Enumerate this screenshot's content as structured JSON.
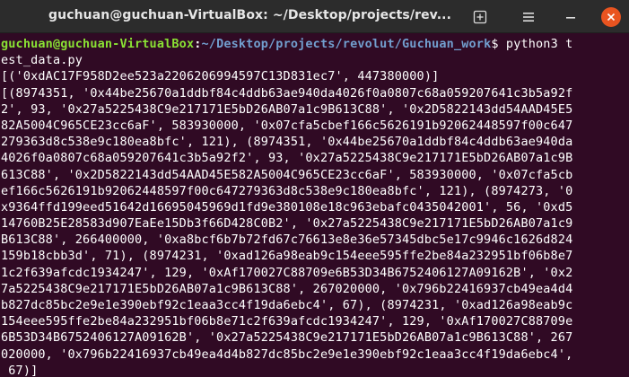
{
  "window": {
    "title": "guchuan@guchuan-VirtualBox: ~/Desktop/projects/revolut/Guchuan_work"
  },
  "titlebar_icons": {
    "new_tab": "new-tab-icon",
    "menu": "hamburger-menu-icon",
    "minimize": "minimize-icon",
    "close": "close-icon"
  },
  "terminal": {
    "prompt_user": "guchuan@guchuan-VirtualBox",
    "prompt_sep": ":",
    "prompt_path": "~/Desktop/projects/revolut/Guchuan_work",
    "prompt_symbol": "$ ",
    "command_head": "python3 t",
    "lines": [
      "est_data.py",
      "[('0xdAC17F958D2ee523a2206206994597C13D831ec7', 447380000)]",
      "[(8974351, '0x44be25670a1ddbf84c4ddb63ae940da4026f0a0807c68a059207641c3b5a92f",
      "2', 93, '0x27a5225438C9e217171E5bD26AB07a1c9B613C88', '0x2D5822143dd54AAD45E5",
      "82A5004C965CE23cc6aF', 583930000, '0x07cfa5cbef166c5626191b92062448597f00c647",
      "279363d8c538e9c180ea8bfc', 121), (8974351, '0x44be25670a1ddbf84c4ddb63ae940da",
      "4026f0a0807c68a059207641c3b5a92f2', 93, '0x27a5225438C9e217171E5bD26AB07a1c9B",
      "613C88', '0x2D5822143dd54AAD45E582A5004C965CE23cc6aF', 583930000, '0x07cfa5cb",
      "ef166c5626191b92062448597f00c647279363d8c538e9c180ea8bfc', 121), (8974273, '0",
      "x9364ffd199eed51642d16695045969d1fd9e380108e18c963ebafc0435042001', 56, '0xd5",
      "14760B25E28583d907EaEe15Db3f66D428C0B2', '0x27a5225438C9e217171E5bD26AB07a1c9",
      "B613C88', 266400000, '0xa8bcf6b7b72fd67c76613e8e36e57345dbc5e17c9946c1626d824",
      "159b18cbb3d', 71), (8974231, '0xad126a98eab9c154eee595ffe2be84a232951bf06b8e7",
      "1c2f639afcdc1934247', 129, '0xAf170027C88709e6B53D34B6752406127A09162B', '0x2",
      "7a5225438C9e217171E5bD26AB07a1c9B613C88', 267020000, '0x796b22416937cb49ea4d4",
      "b827dc85bc2e9e1e390ebf92c1eaa3cc4f19da6ebc4', 67), (8974231, '0xad126a98eab9c",
      "154eee595ffe2be84a232951bf06b8e71c2f639afcdc1934247', 129, '0xAf170027C88709e",
      "6B53D34B6752406127A09162B', '0x27a5225438C9e217171E5bD26AB07a1c9B613C88', 267",
      "020000, '0x796b22416937cb49ea4d4b827dc85bc2e9e1e390ebf92c1eaa3cc4f19da6ebc4',",
      " 67)]"
    ]
  }
}
